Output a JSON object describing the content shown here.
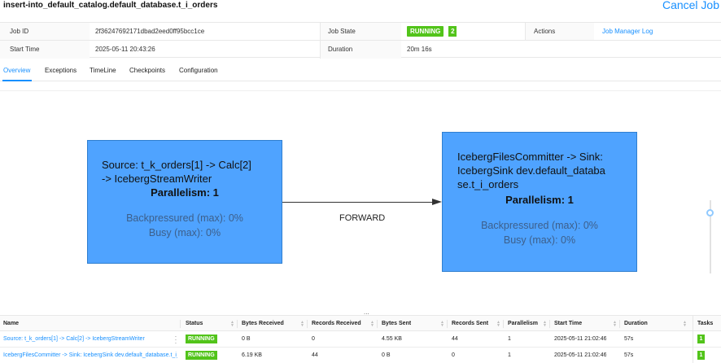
{
  "header": {
    "job_name": "insert-into_default_catalog.default_database.t_i_orders",
    "cancel_label": "Cancel Job"
  },
  "info": {
    "job_id_label": "Job ID",
    "job_id": "2f36247692171dbad2eed0ff95bcc1ce",
    "job_state_label": "Job State",
    "job_state": "RUNNING",
    "job_state_count": "2",
    "actions_label": "Actions",
    "actions_link": "Job Manager Log",
    "start_time_label": "Start Time",
    "start_time": "2025-05-11 20:43:26",
    "duration_label": "Duration",
    "duration": "20m 16s"
  },
  "tabs": [
    "Overview",
    "Exceptions",
    "TimeLine",
    "Checkpoints",
    "Configuration"
  ],
  "active_tab": "Overview",
  "graph": {
    "node1": {
      "title_line1": "Source: t_k_orders[1] -> Calc[2]",
      "title_line2": "-> IcebergStreamWriter",
      "parallelism": "Parallelism: 1",
      "backpressured": "Backpressured (max): 0%",
      "busy": "Busy (max): 0%"
    },
    "node2": {
      "title_line1": "IcebergFilesCommitter -> Sink:",
      "title_line2": "IcebergSink dev.default_databa",
      "title_line3": "se.t_i_orders",
      "parallelism": "Parallelism: 1",
      "backpressured": "Backpressured (max): 0%",
      "busy": "Busy (max): 0%"
    },
    "edge_label": "FORWARD"
  },
  "splitter_glyph": "...",
  "vertices": {
    "columns": [
      "Name",
      "Status",
      "Bytes Received",
      "Records Received",
      "Bytes Sent",
      "Records Sent",
      "Parallelism",
      "Start Time",
      "Duration",
      "Tasks"
    ],
    "rows": [
      {
        "name": "Source: t_k_orders[1] -> Calc[2] -> IcebergStreamWriter",
        "status": "RUNNING",
        "bytes_received": "0 B",
        "records_received": "0",
        "bytes_sent": "4.55 KB",
        "records_sent": "44",
        "parallelism": "1",
        "start_time": "2025-05-11 21:02:46",
        "duration": "57s",
        "tasks": "1"
      },
      {
        "name": "IcebergFilesCommitter -> Sink: IcebergSink dev.default_database.t_i_ord...",
        "status": "RUNNING",
        "bytes_received": "6.19 KB",
        "records_received": "44",
        "bytes_sent": "0 B",
        "records_sent": "0",
        "parallelism": "1",
        "start_time": "2025-05-11 21:02:46",
        "duration": "57s",
        "tasks": "1"
      }
    ]
  },
  "colors": {
    "accent": "#1890ff",
    "running": "#52c41a",
    "node_fill": "#4fa3ff"
  }
}
